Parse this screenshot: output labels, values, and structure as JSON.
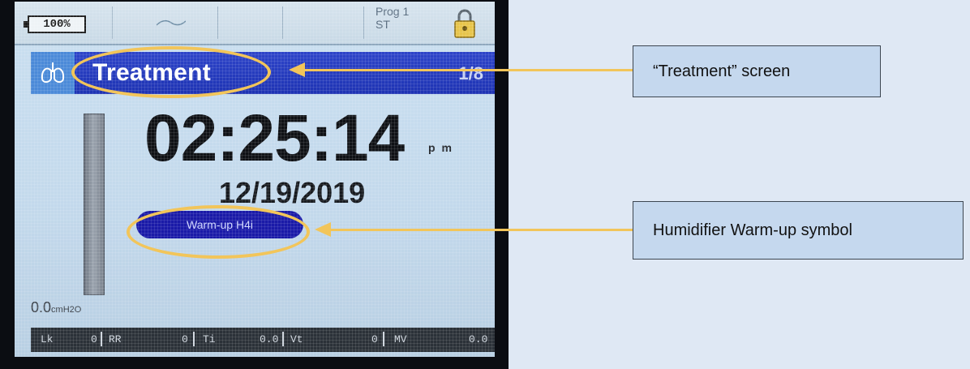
{
  "status": {
    "battery": "100%",
    "prog_line1": "Prog 1",
    "prog_line2": "ST"
  },
  "header": {
    "title": "Treatment",
    "page": "1/8"
  },
  "clock": {
    "time": "02:25:14",
    "ampm": "p m",
    "date": "12/19/2019"
  },
  "warmup": {
    "label": "Warm-up H4i"
  },
  "pressure": {
    "value": "0.0",
    "unit": "cmH2O"
  },
  "params": [
    {
      "name": "Lk",
      "value": "0"
    },
    {
      "name": "RR",
      "value": "0"
    },
    {
      "name": "Ti",
      "value": "0.0"
    },
    {
      "name": "Vt",
      "value": "0"
    },
    {
      "name": "MV",
      "value": "0.0"
    }
  ],
  "callouts": {
    "treatment": "“Treatment” screen",
    "humidifier": "Humidifier Warm-up symbol"
  },
  "colors": {
    "highlight": "#f2c55a",
    "titlebar": "#1e33b3",
    "callout_bg": "#c5d8ee"
  }
}
